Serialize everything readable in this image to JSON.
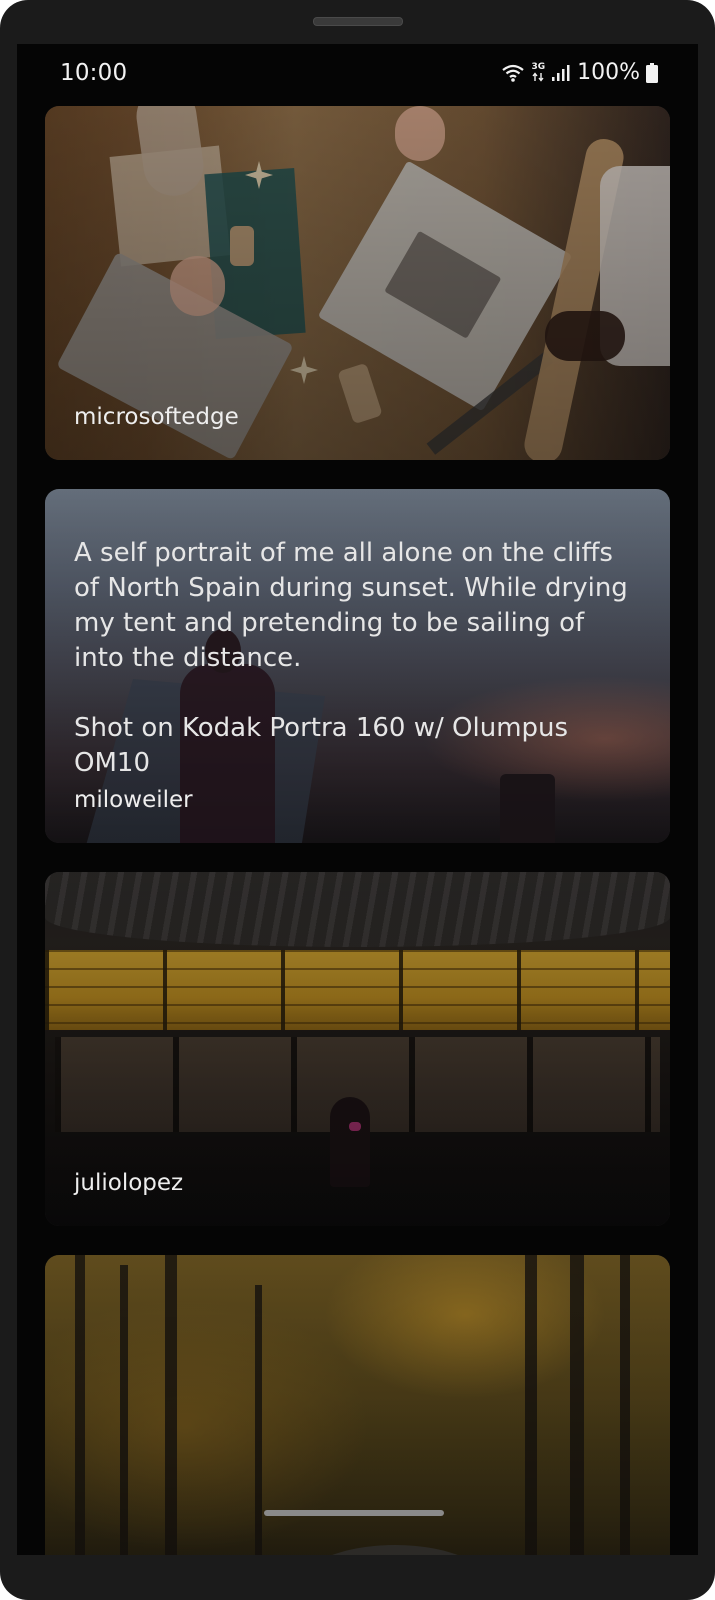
{
  "status_bar": {
    "time": "10:00",
    "network": "3G",
    "battery_percent": "100%",
    "icons": [
      "wifi-icon",
      "network-arrows-icon",
      "signal-bars-icon",
      "battery-icon"
    ]
  },
  "feed": {
    "cards": [
      {
        "username": "microsoftedge",
        "description": "",
        "image": "desk-crafting-photo"
      },
      {
        "username": "miloweiler",
        "description": "A self portrait of me all alone on the cliffs of North Spain during sunset. While drying my tent and pretending to be sailing of into the distance.\n\nShot on Kodak Portra 160 w/ Olumpus OM10",
        "image": "sunset-cliff-photo"
      },
      {
        "username": "juliolopez",
        "description": "",
        "image": "night-building-photo"
      },
      {
        "username": "",
        "description": "",
        "image": "autumn-forest-photo"
      }
    ]
  },
  "colors": {
    "screen_background": "#050505",
    "text": "#eeeeee",
    "frame": "#1b1b1b"
  }
}
